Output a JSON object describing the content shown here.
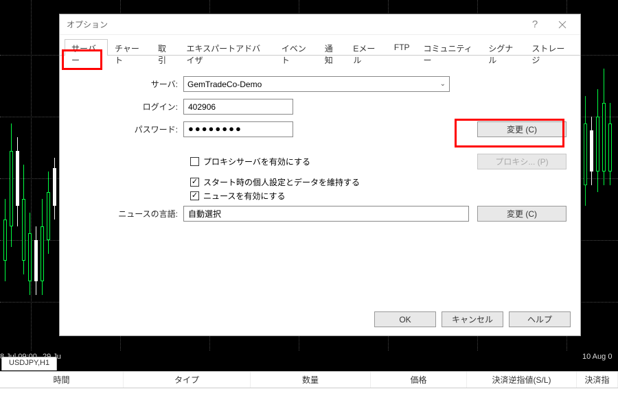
{
  "background": {
    "x_labels": [
      "8 Jul 09:00",
      "29 Ju",
      "10 Aug 0"
    ],
    "chart_tab": "USDJPY,H1",
    "table_headers": [
      "時間",
      "タイプ",
      "数量",
      "価格",
      "決済逆指値(S/L)",
      "決済指"
    ]
  },
  "dialog": {
    "title": "オプション",
    "tabs": [
      "サーバー",
      "チャート",
      "取引",
      "エキスパートアドバイザ",
      "イベント",
      "通知",
      "Eメール",
      "FTP",
      "コミュニティー",
      "シグナル",
      "ストレージ"
    ],
    "active_tab_index": 0,
    "fields": {
      "server_label": "サーバ:",
      "server_value": "GemTradeCo-Demo",
      "login_label": "ログイン:",
      "login_value": "402906",
      "password_label": "パスワード:",
      "password_value": "●●●●●●●●",
      "change_btn": "変更 (C)",
      "proxy_chk": "プロキシサーバを有効にする",
      "proxy_btn": "プロキシ... (P)",
      "keep_settings_chk": "スタート時の個人設定とデータを維持する",
      "news_chk": "ニュースを有効にする",
      "news_lang_label": "ニュースの言語:",
      "news_lang_value": "自動選択",
      "change_btn2": "変更 (C)"
    },
    "buttons": {
      "ok": "OK",
      "cancel": "キャンセル",
      "help": "ヘルプ"
    }
  }
}
